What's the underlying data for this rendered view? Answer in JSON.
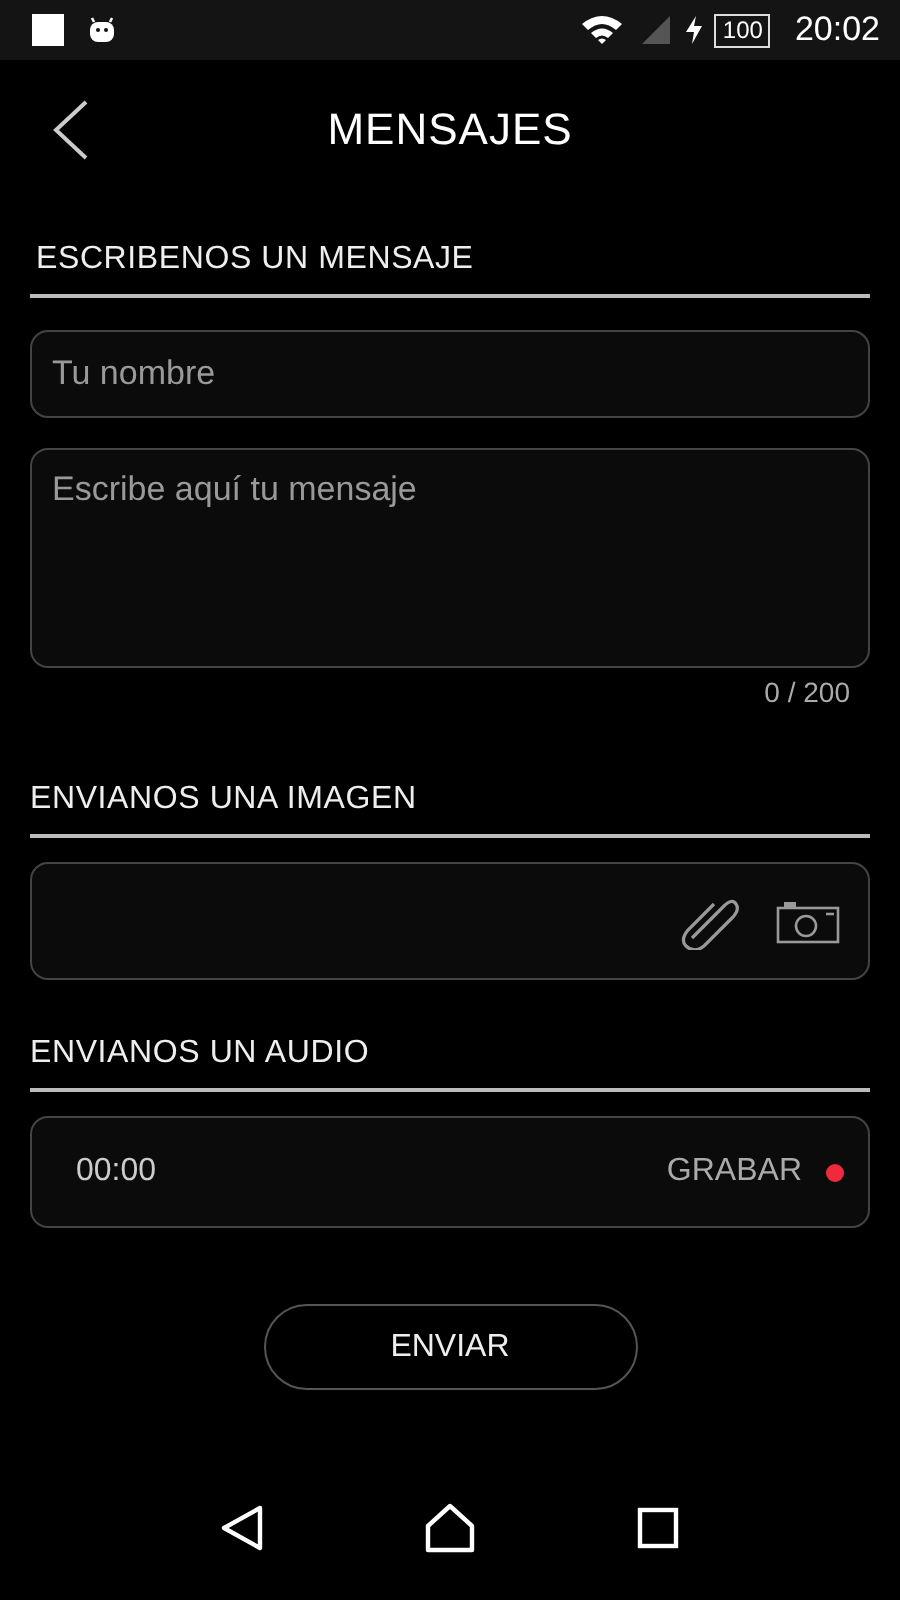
{
  "status_bar": {
    "battery": "100",
    "time": "20:02"
  },
  "header": {
    "title": "MENSAJES"
  },
  "message_section": {
    "title": "ESCRIBENOS UN MENSAJE",
    "name_placeholder": "Tu nombre",
    "message_placeholder": "Escribe aquí tu mensaje",
    "counter": "0 / 200"
  },
  "image_section": {
    "title": "ENVIANOS UNA IMAGEN"
  },
  "audio_section": {
    "title": "ENVIANOS UN AUDIO",
    "time": "00:00",
    "record_label": "GRABAR"
  },
  "send_button": "ENVIAR"
}
